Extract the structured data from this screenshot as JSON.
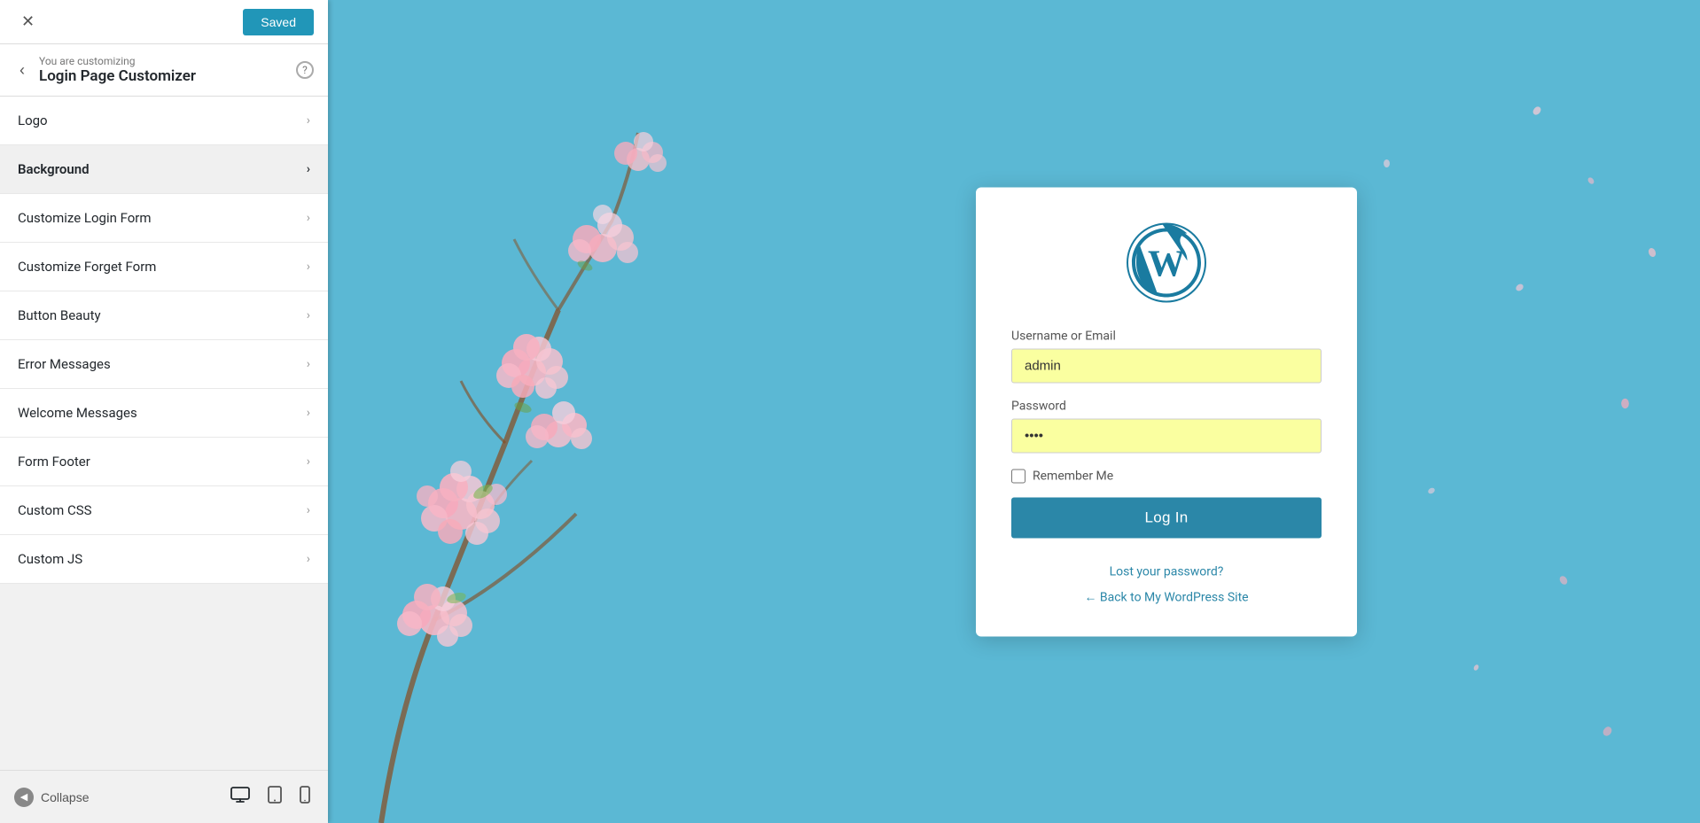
{
  "topBar": {
    "savedLabel": "Saved",
    "closeAriaLabel": "Close"
  },
  "customizingHeader": {
    "backAriaLabel": "Back",
    "customizingLabel": "You are customizing",
    "title": "Login Page Customizer",
    "helpAriaLabel": "Help"
  },
  "menuItems": [
    {
      "id": "logo",
      "label": "Logo",
      "active": false
    },
    {
      "id": "background",
      "label": "Background",
      "active": true
    },
    {
      "id": "customize-login-form",
      "label": "Customize Login Form",
      "active": false
    },
    {
      "id": "customize-forget-form",
      "label": "Customize Forget Form",
      "active": false
    },
    {
      "id": "button-beauty",
      "label": "Button Beauty",
      "active": false
    },
    {
      "id": "error-messages",
      "label": "Error Messages",
      "active": false
    },
    {
      "id": "welcome-messages",
      "label": "Welcome Messages",
      "active": false
    },
    {
      "id": "form-footer",
      "label": "Form Footer",
      "active": false
    },
    {
      "id": "custom-css",
      "label": "Custom CSS",
      "active": false
    },
    {
      "id": "custom-js",
      "label": "Custom JS",
      "active": false
    }
  ],
  "bottomBar": {
    "collapseLabel": "Collapse"
  },
  "loginCard": {
    "usernameLabel": "Username or Email",
    "usernamePlaceholder": "",
    "usernameValue": "admin",
    "passwordLabel": "Password",
    "passwordValue": "••••",
    "rememberLabel": "Remember Me",
    "loginButton": "Log In",
    "forgotLink": "Lost your password?",
    "backLink": "← Back to My WordPress Site"
  }
}
